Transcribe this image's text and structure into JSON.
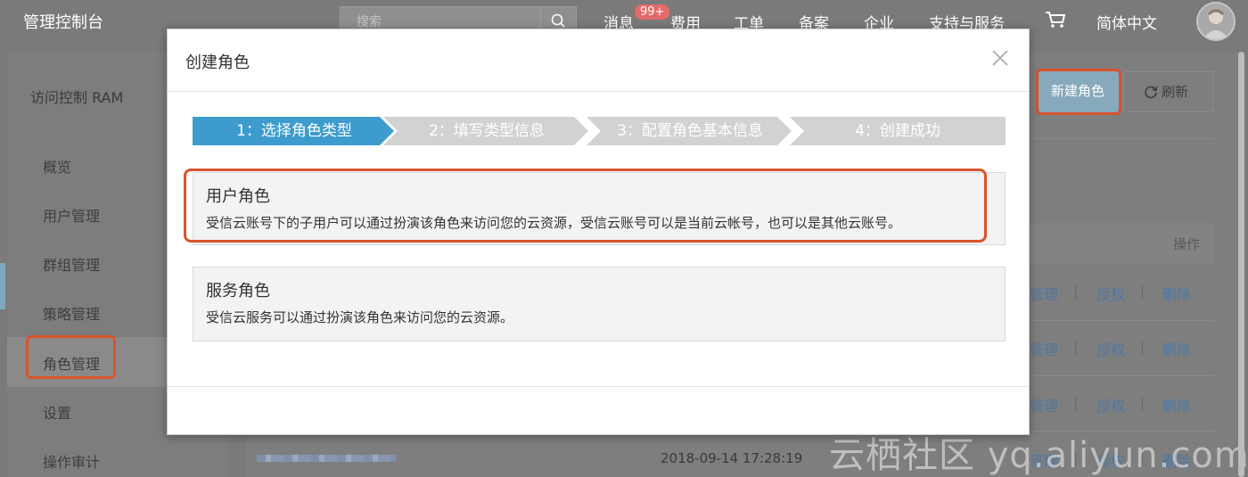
{
  "header": {
    "brand": "管理控制台",
    "search_placeholder": "搜索",
    "nav": {
      "messages": "消息",
      "messages_badge": "99+",
      "billing": "费用",
      "tickets": "工单",
      "icp": "备案",
      "enterprise": "企业",
      "support": "支持与服务",
      "language": "简体中文"
    }
  },
  "sidebar": {
    "title": "访问控制 RAM",
    "items": [
      {
        "label": "概览"
      },
      {
        "label": "用户管理"
      },
      {
        "label": "群组管理"
      },
      {
        "label": "策略管理"
      },
      {
        "label": "角色管理",
        "active": true
      },
      {
        "label": "设置"
      },
      {
        "label": "操作审计"
      }
    ]
  },
  "main": {
    "new_role_button": "新建角色",
    "refresh_button": "刷新",
    "ops_header": "操作",
    "row_actions": [
      "管理",
      "授权",
      "删除"
    ],
    "last_row_timestamp": "2018-09-14 17:28:19",
    "watermark": "云栖社区 yq.aliyun.com"
  },
  "modal": {
    "title": "创建角色",
    "steps": [
      {
        "label": "1：选择角色类型",
        "active": true
      },
      {
        "label": "2：填写类型信息",
        "active": false
      },
      {
        "label": "3：配置角色基本信息",
        "active": false
      },
      {
        "label": "4：创建成功",
        "active": false
      }
    ],
    "options": [
      {
        "title": "用户角色",
        "description": "受信云账号下的子用户可以通过扮演该角色来访问您的云资源，受信云账号可以是当前云帐号，也可以是其他云账号。",
        "highlighted": true
      },
      {
        "title": "服务角色",
        "description": "受信云服务可以通过扮演该角色来访问您的云资源。",
        "highlighted": false
      }
    ]
  },
  "colors": {
    "step_active": "#3d9ccd",
    "step_inactive": "#d2d2d2",
    "highlight_border": "#d9542c",
    "link": "#4f78a2"
  },
  "icons": {
    "search": "search-icon",
    "cart": "cart-icon",
    "close": "close-icon",
    "refresh": "refresh-icon",
    "avatar": "avatar-icon"
  }
}
